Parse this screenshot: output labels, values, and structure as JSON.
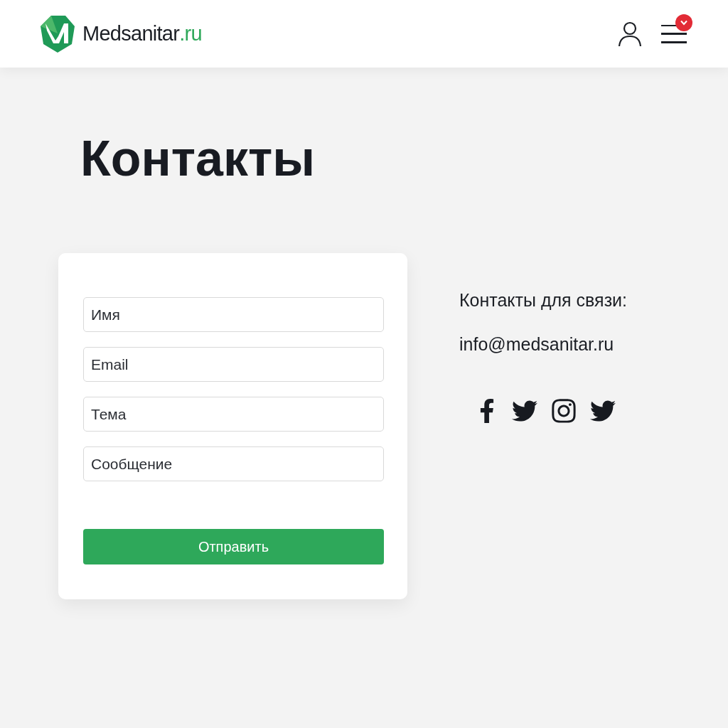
{
  "header": {
    "brand_name": "Medsanitar",
    "brand_domain": ".ru",
    "menu_badge": true
  },
  "page_title": "Контакты",
  "form": {
    "fields": [
      {
        "placeholder": "Имя"
      },
      {
        "placeholder": "Email"
      },
      {
        "placeholder": "Тема"
      },
      {
        "placeholder": "Сообщение"
      }
    ],
    "submit": "Отправить"
  },
  "contacts": {
    "heading": "Контакты для связи:",
    "email": "info@medsanitar.ru",
    "socials": [
      {
        "kind": "facebook"
      },
      {
        "kind": "twitter"
      },
      {
        "kind": "instagram"
      },
      {
        "kind": "twitter"
      }
    ]
  }
}
